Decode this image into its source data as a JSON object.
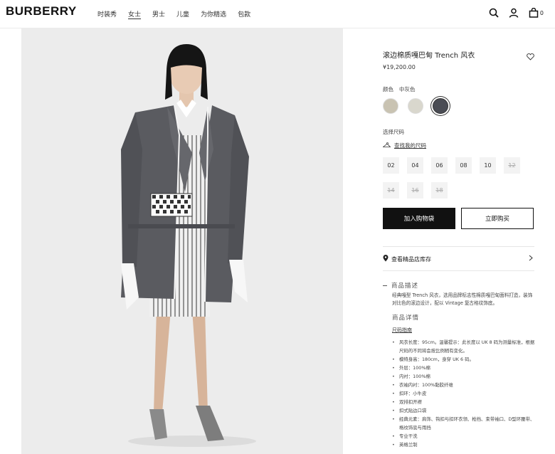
{
  "header": {
    "logo": "BURBERRY",
    "nav": [
      "时装秀",
      "女士",
      "男士",
      "儿童",
      "为你精选",
      "包款"
    ],
    "active_nav": 1,
    "bag_count": "0"
  },
  "product": {
    "title": "滚边棉质嘎巴甸 Trench 风衣",
    "price": "¥19,200.00",
    "color_label": "颜色",
    "color_value": "中灰色",
    "swatches": [
      {
        "color": "#c9c3b2"
      },
      {
        "color": "#d9d7cd"
      },
      {
        "color": "#4a4c54",
        "selected": true
      }
    ],
    "size_label": "选择尺码",
    "size_guide": "查找我的尺码",
    "sizes": [
      {
        "label": "02",
        "available": true
      },
      {
        "label": "04",
        "available": true
      },
      {
        "label": "06",
        "available": true
      },
      {
        "label": "08",
        "available": true
      },
      {
        "label": "10",
        "available": true
      },
      {
        "label": "12",
        "available": false
      },
      {
        "label": "14",
        "available": false
      },
      {
        "label": "16",
        "available": false
      },
      {
        "label": "18",
        "available": false
      }
    ],
    "add_to_bag": "加入购物袋",
    "buy_now": "立即购买",
    "store_stock": "查看精品店库存",
    "description_heading": "商品描述",
    "description": "经典嘎型 Trench 风衣，选用品牌标志性棉质嘎巴甸面料打造，装饰对比色的滚边设计，配以 Vintage 复古格纹饰底。",
    "details_heading": "商品详情",
    "fit_guide": "尺码指南",
    "details": [
      "风衣长度：95cm。温馨提示：此长度以 UK 8 码为测量标准，根据尺码的不同将会按比例稍有变化。",
      "模特身高：180cm，身穿 UK 6 码。",
      "外层：100%棉",
      "内衬：100%棉",
      "衣袖内衬：100%黏胶纤维",
      "扣环：小牛皮",
      "双排扣开襟",
      "扣式贴边口袋",
      "经典元素：肩饰、钩扣与扣环衣领、枪挡、束带袖口、D型环腰带、格纹饰底与雨挡",
      "专业干洗",
      "英格兰制"
    ]
  },
  "colors": {
    "primary_button": "#111111",
    "image_background": "#ececec"
  },
  "icons": [
    "search-icon",
    "user-icon",
    "bag-icon",
    "heart-icon",
    "hanger-icon",
    "location-pin-icon",
    "chevron-right-icon"
  ]
}
